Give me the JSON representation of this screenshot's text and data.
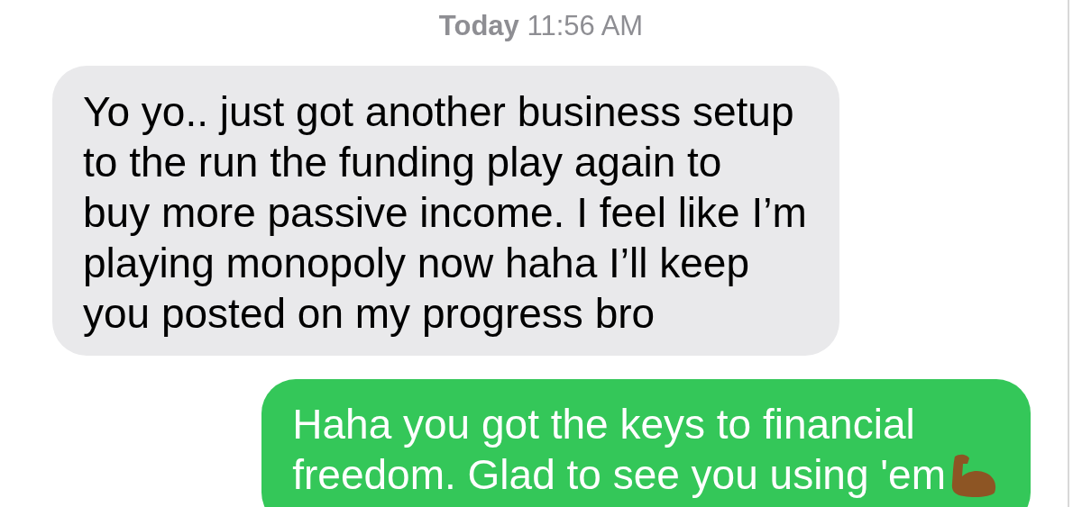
{
  "timestamp": "**Today** 11:56 AM",
  "messages": [
    {
      "kind": "received",
      "lines": [
        "Yo yo.. just got another business setup",
        "to the run the funding play again to",
        "buy more passive income. I feel like I’m",
        "playing monopoly now haha I’ll keep",
        "you posted on my progress bro"
      ],
      "has_emoji": false
    },
    {
      "kind": "sent",
      "lines": [
        "Haha you got the keys to financial",
        "freedom. Glad to see you using 'em"
      ],
      "has_emoji": true
    }
  ]
}
